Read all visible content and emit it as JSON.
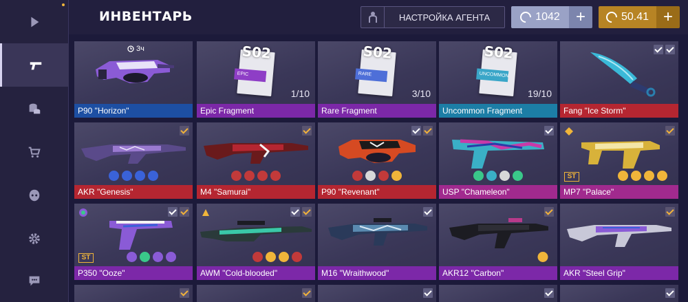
{
  "header": {
    "title": "ИНВЕНТАРЬ",
    "agent_button": "НАСТРОЙКА АГЕНТА",
    "silver_amount": "1042",
    "gold_amount": "50.41"
  },
  "sidebar": {
    "items": [
      {
        "icon": "play-icon",
        "active": false
      },
      {
        "icon": "pistol-icon",
        "active": true
      },
      {
        "icon": "coins-icon",
        "active": false
      },
      {
        "icon": "cart-icon",
        "active": false
      },
      {
        "icon": "clan-icon",
        "active": false
      },
      {
        "icon": "gear-icon",
        "active": false
      },
      {
        "icon": "chat-icon",
        "active": false
      }
    ]
  },
  "inventory": {
    "row1": [
      {
        "name": "P90 \"Horizon\"",
        "color": "blue",
        "timer": "3ч"
      },
      {
        "name": "Epic Fragment",
        "color": "purple",
        "count": "1/10",
        "rarity": "EPIC"
      },
      {
        "name": "Rare Fragment",
        "color": "purple",
        "count": "3/10",
        "rarity": "RARE"
      },
      {
        "name": "Uncommon Fragment",
        "color": "teal",
        "count": "19/10",
        "rarity": "UNCOMMON"
      },
      {
        "name": "Fang \"Ice Storm\"",
        "color": "red"
      }
    ],
    "row2": [
      {
        "name": "AKR \"Genesis\"",
        "color": "red"
      },
      {
        "name": "M4 \"Samurai\"",
        "color": "red"
      },
      {
        "name": "P90 \"Revenant\"",
        "color": "red"
      },
      {
        "name": "USP \"Chameleon\"",
        "color": "magenta"
      },
      {
        "name": "MP7 \"Palace\"",
        "color": "magenta",
        "badge": "ST"
      }
    ],
    "row3": [
      {
        "name": "P350 \"Ooze\"",
        "color": "purple",
        "badge": "ST"
      },
      {
        "name": "AWM \"Cold-blooded\"",
        "color": "purple"
      },
      {
        "name": "M16 \"Wraithwood\"",
        "color": "purple"
      },
      {
        "name": "AKR12 \"Carbon\"",
        "color": "purple"
      },
      {
        "name": "AKR \"Steel Grip\"",
        "color": "purple"
      }
    ]
  },
  "fragment_label": "S02",
  "colors": {
    "blue": "#1d4fa3",
    "purple": "#7c28a8",
    "teal": "#1c7ea6",
    "red": "#b52631",
    "magenta": "#a12a8e",
    "gold": "#f0b53a"
  }
}
